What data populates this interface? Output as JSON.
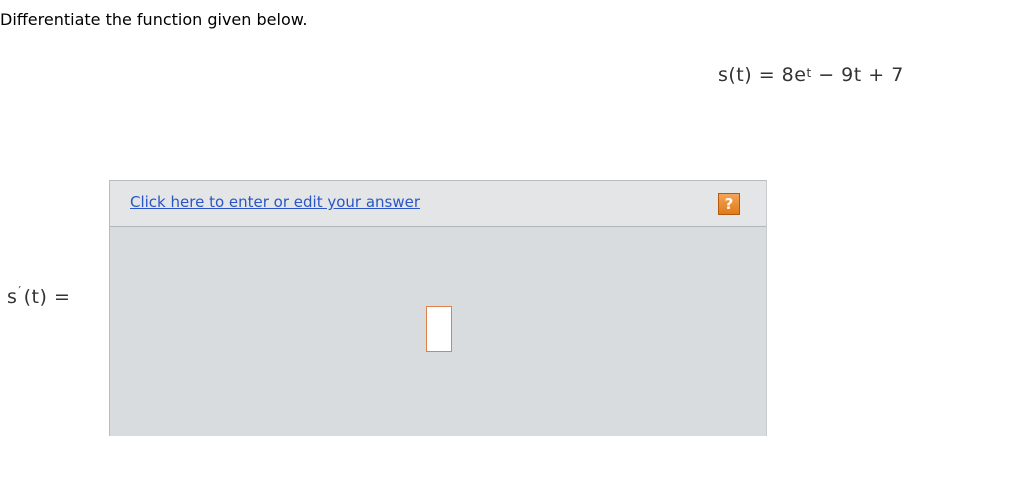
{
  "instruction": "Differentiate the function given below.",
  "equation": {
    "lhs": "s(t) = 8e",
    "exponent": "t",
    "rhs": " − 9t + 7"
  },
  "answer_label": {
    "func": "s",
    "prime": "′",
    "rest": "(t) ="
  },
  "panel": {
    "edit_link_label": "Click here to enter or edit your answer",
    "help_icon": "?",
    "help_icon_name": "help-icon"
  },
  "colors": {
    "link": "#2b55c6",
    "panel_bg": "#d9dcdf",
    "header_bg": "#e4e5e6",
    "help_orange": "#e07a18",
    "answer_box_border": "#e0804a"
  }
}
